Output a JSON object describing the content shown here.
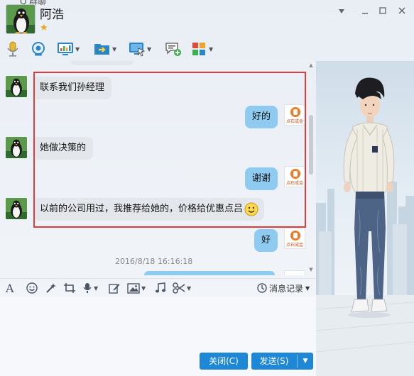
{
  "window": {
    "top_edge_text": "Q 群聊"
  },
  "header": {
    "contact_name": "阿浩"
  },
  "messages": [
    {
      "side": "in",
      "text": "联系我们孙经理"
    },
    {
      "side": "out",
      "text": "好的",
      "sender_logo_text": "点石成金"
    },
    {
      "side": "in",
      "text": "她做决策的"
    },
    {
      "side": "out",
      "text": "谢谢",
      "sender_logo_text": "点石成金"
    },
    {
      "side": "in",
      "text": "以前的公司用过，我推荐给她的，价格给优惠点吕"
    },
    {
      "side": "out",
      "text": "好",
      "sender_logo_text": "点石成金"
    }
  ],
  "timestamp": "2016/8/18 16:16:18",
  "input_toolbar": {
    "history_label": "消息记录"
  },
  "buttons": {
    "close_label": "关闭(C)",
    "send_label": "发送(S)"
  },
  "colors": {
    "accent": "#1e88d6",
    "bubble_out": "#8fcbf1",
    "bubble_in": "#e3e6ea",
    "highlight": "#e23b3b"
  },
  "icons": {
    "header_toolbar": [
      "microphone-icon",
      "video-camera-icon",
      "screen-share-icon",
      "file-transfer-icon",
      "remote-desktop-icon",
      "new-chat-icon",
      "apps-icon"
    ],
    "input_toolbar": [
      "font-icon",
      "emoji-icon",
      "magic-icon",
      "screenshot-icon",
      "voice-icon",
      "edit-icon",
      "image-icon",
      "music-icon",
      "scissors-icon"
    ]
  }
}
